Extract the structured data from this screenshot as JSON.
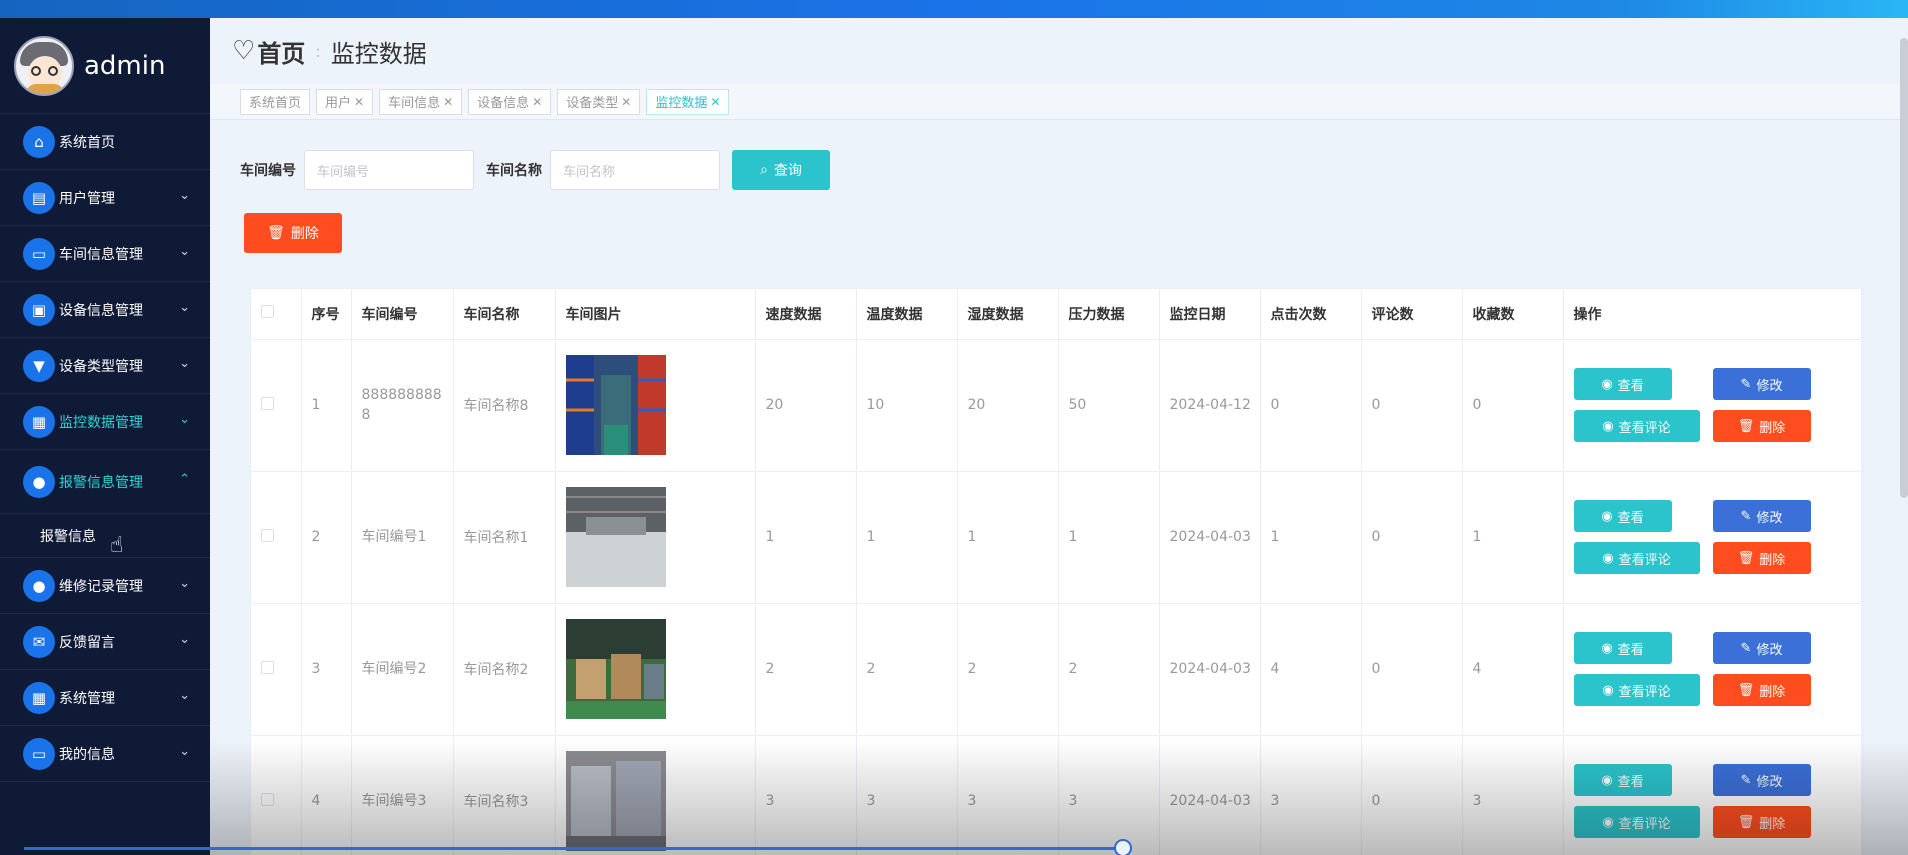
{
  "user": {
    "name": "admin"
  },
  "sidebar": {
    "items": [
      {
        "label": "系统首页",
        "icon": "home-icon"
      },
      {
        "label": "用户管理",
        "icon": "clipboard-icon"
      },
      {
        "label": "车间信息管理",
        "icon": "monitor-icon"
      },
      {
        "label": "设备信息管理",
        "icon": "device-icon"
      },
      {
        "label": "设备类型管理",
        "icon": "pin-icon"
      },
      {
        "label": "监控数据管理",
        "icon": "calendar-icon"
      },
      {
        "label": "报警信息管理",
        "icon": "person-icon"
      },
      {
        "label": "维修记录管理",
        "icon": "person-icon"
      },
      {
        "label": "反馈留言",
        "icon": "ticket-icon"
      },
      {
        "label": "系统管理",
        "icon": "grid-icon"
      },
      {
        "label": "我的信息",
        "icon": "card-icon"
      }
    ],
    "submenu": {
      "label": "报警信息"
    }
  },
  "header": {
    "home": "首页",
    "title": "监控数据"
  },
  "tabs": [
    {
      "label": "系统首页",
      "closable": false
    },
    {
      "label": "用户",
      "closable": true
    },
    {
      "label": "车间信息",
      "closable": true
    },
    {
      "label": "设备信息",
      "closable": true
    },
    {
      "label": "设备类型",
      "closable": true
    },
    {
      "label": "监控数据",
      "closable": true
    }
  ],
  "search": {
    "field1_label": "车间编号",
    "field1_placeholder": "车间编号",
    "field2_label": "车间名称",
    "field2_placeholder": "车间名称",
    "query_label": "查询",
    "delete_label": "删除"
  },
  "table": {
    "headers": [
      "序号",
      "车间编号",
      "车间名称",
      "车间图片",
      "速度数据",
      "温度数据",
      "湿度数据",
      "压力数据",
      "监控日期",
      "点击次数",
      "评论数",
      "收藏数",
      "操作"
    ],
    "rows": [
      {
        "no": "1",
        "code": "8888888888",
        "name": "车间名称8",
        "speed": "20",
        "temp": "10",
        "humidity": "20",
        "pressure": "50",
        "date": "2024-04-12",
        "clicks": "0",
        "comments": "0",
        "favorites": "0"
      },
      {
        "no": "2",
        "code": "车间编号1",
        "name": "车间名称1",
        "speed": "1",
        "temp": "1",
        "humidity": "1",
        "pressure": "1",
        "date": "2024-04-03",
        "clicks": "1",
        "comments": "0",
        "favorites": "1"
      },
      {
        "no": "3",
        "code": "车间编号2",
        "name": "车间名称2",
        "speed": "2",
        "temp": "2",
        "humidity": "2",
        "pressure": "2",
        "date": "2024-04-03",
        "clicks": "4",
        "comments": "0",
        "favorites": "4"
      },
      {
        "no": "4",
        "code": "车间编号3",
        "name": "车间名称3",
        "speed": "3",
        "temp": "3",
        "humidity": "3",
        "pressure": "3",
        "date": "2024-04-03",
        "clicks": "3",
        "comments": "0",
        "favorites": "3"
      }
    ],
    "ops": {
      "view": "查看",
      "edit": "修改",
      "comments": "查看评论",
      "delete": "删除"
    }
  },
  "colors": {
    "accent": "#2bc4cc",
    "danger": "#ff4d1f",
    "primary": "#3b70d9",
    "sidebar_bg": "#0f1a36"
  }
}
